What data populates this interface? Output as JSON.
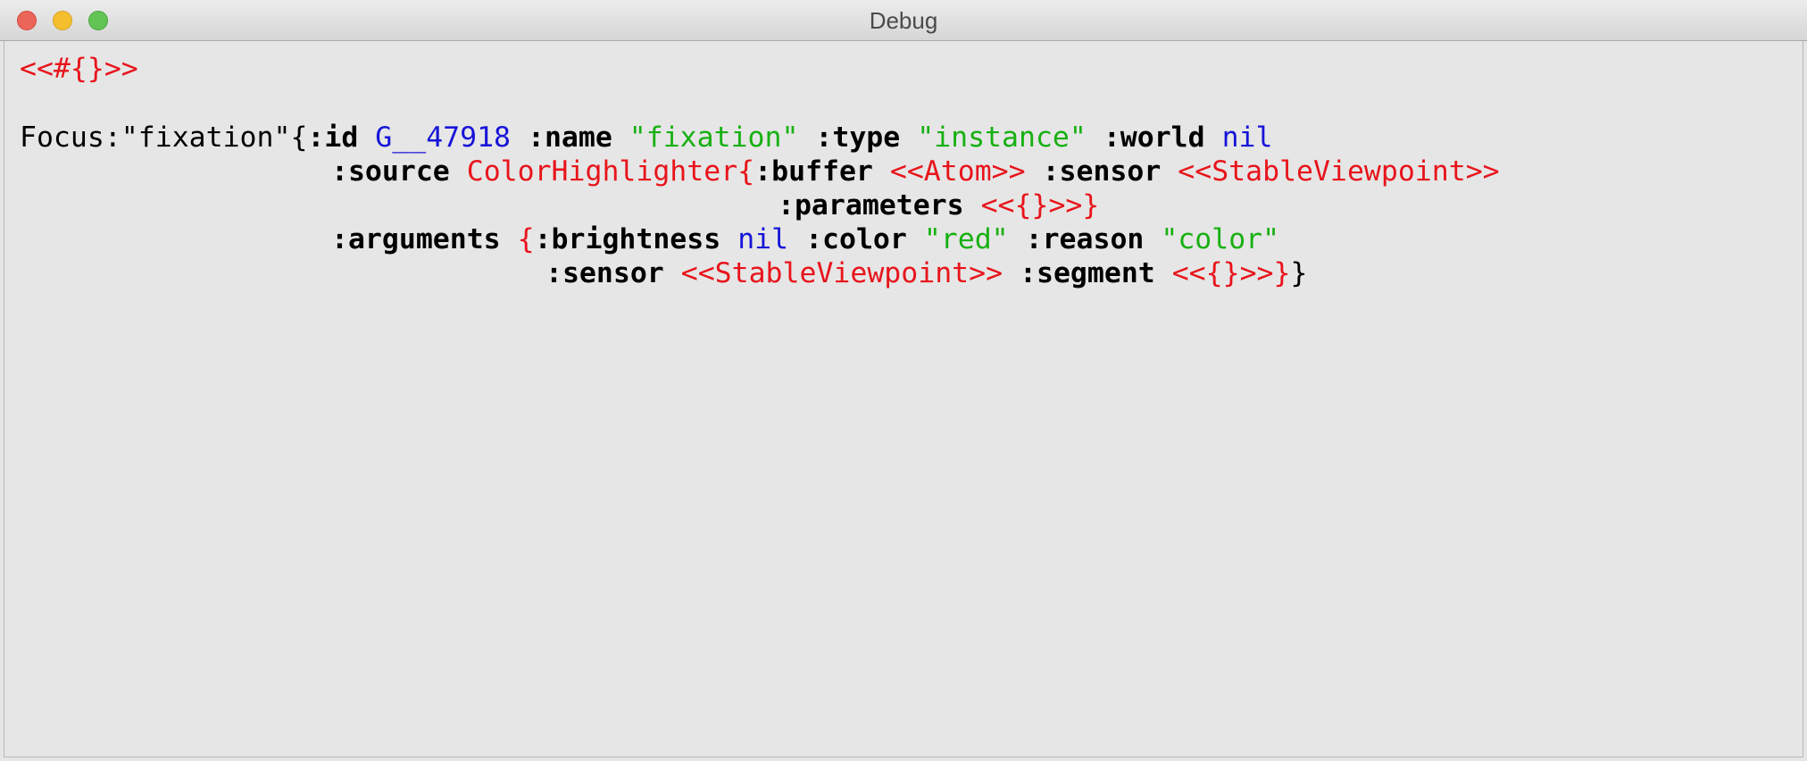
{
  "window": {
    "title": "Debug"
  },
  "colors": {
    "keyword": "#000000",
    "object": "#e8141b",
    "string": "#17b012",
    "symbol": "#1714d8"
  },
  "output": {
    "header": "<<#{}>>",
    "focus_label": "Focus:",
    "focus_name": "\"fixation\"",
    "open_brace": "{",
    "id_key": ":id",
    "id_value": "G__47918",
    "name_key": ":name",
    "name_value": "\"fixation\"",
    "type_key": ":type",
    "type_value": "\"instance\"",
    "world_key": ":world",
    "world_value": "nil",
    "source_key": ":source",
    "source_value": "ColorHighlighter{",
    "buffer_key": ":buffer",
    "buffer_value": "<<Atom>>",
    "sensor_key": ":sensor",
    "sensor_value": "<<StableViewpoint>>",
    "parameters_key": ":parameters",
    "parameters_value": "<<{}>>}",
    "arguments_key": ":arguments",
    "arguments_open": "{",
    "brightness_key": ":brightness",
    "brightness_value": "nil",
    "color_key": ":color",
    "color_value": "\"red\"",
    "reason_key": ":reason",
    "reason_value": "\"color\"",
    "arg_sensor_key": ":sensor",
    "arg_sensor_value": "<<StableViewpoint>>",
    "segment_key": ":segment",
    "segment_value": "<<{}>>}",
    "close_brace": "}"
  }
}
